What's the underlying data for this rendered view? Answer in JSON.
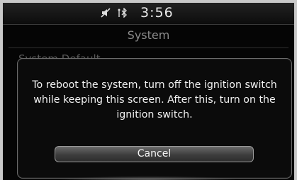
{
  "status_bar": {
    "time": "3:56",
    "icons": [
      "mute-icon",
      "bluetooth-icon"
    ]
  },
  "header": {
    "title": "System"
  },
  "background_list": {
    "first_item": "System Default"
  },
  "dialog": {
    "message": "To reboot the system, turn off the ignition switch while keeping this screen. After this, turn on the ignition switch.",
    "cancel_label": "Cancel"
  },
  "colors": {
    "background": "#050505",
    "text": "#f2f2f2",
    "title": "#8b8b8b"
  }
}
